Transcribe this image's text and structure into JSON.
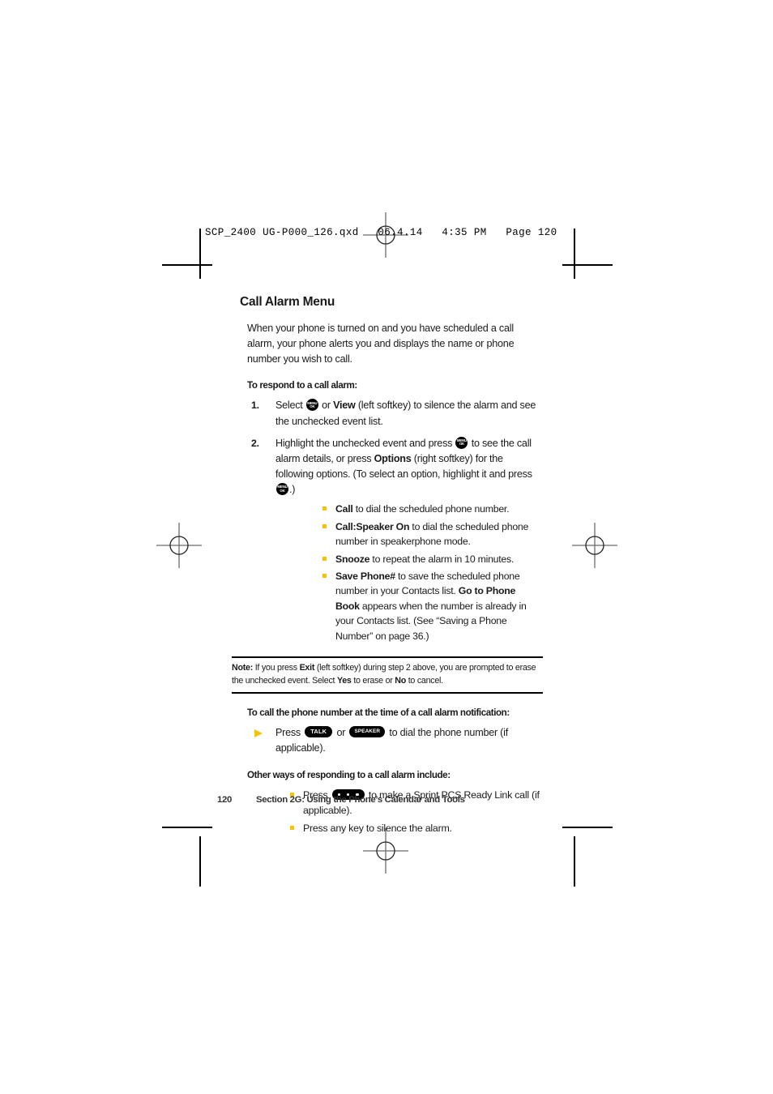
{
  "prepress": {
    "slug": "SCP_2400 UG-P000_126.qxd   06.4.14   4:35 PM   Page 120"
  },
  "colors": {
    "bullet_yellow": "#f5c400",
    "text": "#1a1a1a",
    "footer": "#333333"
  },
  "page": {
    "title": "Call Alarm Menu",
    "intro": "When your phone is turned on and you have scheduled a call alarm, your phone alerts you and displays the name or phone number you wish to call.",
    "procedure1": {
      "heading": "To respond to a call alarm:",
      "steps": [
        {
          "num": "1.",
          "text_before": "Select ",
          "icon": "menu-ok-key",
          "text_after_icon": " or ",
          "bold1": "View",
          "text_end": " (left softkey) to silence the alarm and see the unchecked event list."
        },
        {
          "num": "2.",
          "text_before": "Highlight the unchecked event and press ",
          "icon": "menu-ok-key",
          "text_after_icon": " to see the call alarm details, or press ",
          "bold1": "Options",
          "text_mid": " (right softkey) for the following options. (To select an option, highlight it and press ",
          "icon2": "menu-ok-key",
          "text_end": ".)"
        }
      ],
      "options": [
        {
          "bold": "Call",
          "text": " to dial the scheduled phone number."
        },
        {
          "bold": "Call:Speaker On",
          "text": " to dial the scheduled phone number in speakerphone mode."
        },
        {
          "bold": "Snooze",
          "text": " to repeat the alarm in 10 minutes."
        },
        {
          "bold": "Save Phone#",
          "text": " to save the scheduled phone number in your Contacts list. ",
          "bold2": "Go to Phone Book",
          "text2": " appears when the number is already in your Contacts list. (See “Saving a Phone Number” on page 36.)"
        }
      ]
    },
    "note": {
      "label": "Note:",
      "part1": " If you press ",
      "bold1": "Exit",
      "part2": " (left softkey) during step 2 above, you are prompted to erase the unchecked event. Select ",
      "bold2": "Yes",
      "part3": " to erase or ",
      "bold3": "No",
      "part4": " to cancel."
    },
    "procedure2": {
      "heading": "To call the phone number at the time of a call alarm notification:",
      "item": {
        "text_before": "Press ",
        "icon1": "talk-key",
        "text_mid": " or ",
        "icon2": "speaker-key",
        "text_end": " to dial the phone number (if applicable)."
      }
    },
    "procedure3": {
      "heading": "Other ways of responding to a call alarm include:",
      "items": [
        {
          "text_before": "Press ",
          "icon": "ready-link-key",
          "text_end": " to make a Sprint PCS Ready Link call (if applicable)."
        },
        {
          "text_plain": "Press any key to silence the alarm."
        }
      ]
    },
    "footer": {
      "page_number": "120",
      "section": "Section 2G: Using the Phone’s Calendar and Tools"
    },
    "keys": {
      "menu_ok_line1": "MENU",
      "menu_ok_line2": "OK",
      "talk": "TALK",
      "speaker": "SPEAKER"
    }
  }
}
